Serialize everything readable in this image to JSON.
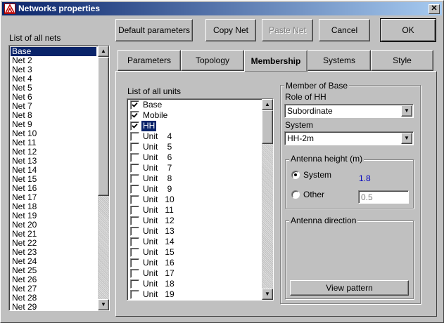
{
  "window": {
    "title": "Networks properties",
    "close_glyph": "✕"
  },
  "icons": {
    "app": "network-app-icon",
    "close": "close-icon",
    "check": "check-icon",
    "scroll_up": "arrow-up-icon",
    "scroll_down": "arrow-down-icon",
    "dropdown": "chevron-down-icon"
  },
  "colors": {
    "titlebar_start": "#0a246a",
    "titlebar_end": "#a6caf0",
    "selection": "#0a246a",
    "value_blue": "#0000c0"
  },
  "toolbar": {
    "default_parameters": "Default parameters",
    "copy_net": "Copy Net",
    "paste_net": "Paste Net",
    "cancel": "Cancel",
    "ok": "OK"
  },
  "nets": {
    "label": "List of all nets",
    "items": [
      "Base",
      "Net  2",
      "Net  3",
      "Net  4",
      "Net  5",
      "Net  6",
      "Net  7",
      "Net  8",
      "Net  9",
      "Net 10",
      "Net 11",
      "Net 12",
      "Net 13",
      "Net 14",
      "Net 15",
      "Net 16",
      "Net 17",
      "Net 18",
      "Net 19",
      "Net 20",
      "Net 21",
      "Net 22",
      "Net 23",
      "Net 24",
      "Net 25",
      "Net 26",
      "Net 27",
      "Net 28",
      "Net 29"
    ],
    "selected_index": 0
  },
  "tabs": [
    "Parameters",
    "Topology",
    "Membership",
    "Systems",
    "Style"
  ],
  "active_tab": 2,
  "units": {
    "label": "List of all units",
    "items": [
      {
        "name": "Base",
        "checked": true
      },
      {
        "name": "Mobile",
        "checked": true
      },
      {
        "name": "HH",
        "checked": true
      },
      {
        "name": "Unit    4",
        "checked": false
      },
      {
        "name": "Unit    5",
        "checked": false
      },
      {
        "name": "Unit    6",
        "checked": false
      },
      {
        "name": "Unit    7",
        "checked": false
      },
      {
        "name": "Unit    8",
        "checked": false
      },
      {
        "name": "Unit    9",
        "checked": false
      },
      {
        "name": "Unit   10",
        "checked": false
      },
      {
        "name": "Unit   11",
        "checked": false
      },
      {
        "name": "Unit   12",
        "checked": false
      },
      {
        "name": "Unit   13",
        "checked": false
      },
      {
        "name": "Unit   14",
        "checked": false
      },
      {
        "name": "Unit   15",
        "checked": false
      },
      {
        "name": "Unit   16",
        "checked": false
      },
      {
        "name": "Unit   17",
        "checked": false
      },
      {
        "name": "Unit   18",
        "checked": false
      },
      {
        "name": "Unit   19",
        "checked": false
      }
    ],
    "selected_index": 2
  },
  "member": {
    "group_label": "Member of Base",
    "role_label": "Role of HH",
    "role_value": "Subordinate",
    "system_label": "System",
    "system_value": "HH-2m",
    "antenna_height": {
      "group_label": "Antenna height (m)",
      "system_option": "System",
      "system_value": "1.8",
      "other_option": "Other",
      "other_value": "0.5",
      "selected": "System"
    },
    "antenna_direction": {
      "group_label": "Antenna direction",
      "view_pattern": "View pattern"
    }
  }
}
